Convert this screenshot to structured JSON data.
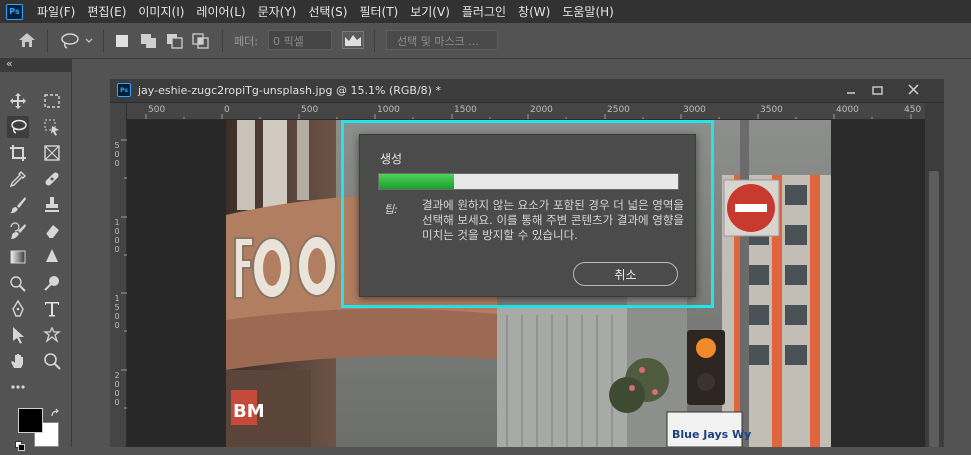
{
  "app": {
    "logo": "Ps"
  },
  "menu": [
    "파일(F)",
    "편집(E)",
    "이미지(I)",
    "레이어(L)",
    "문자(Y)",
    "선택(S)",
    "필터(T)",
    "보기(V)",
    "플러그인",
    "창(W)",
    "도움말(H)"
  ],
  "options_bar": {
    "feather_label": "페더:",
    "feather_value": "0 픽셀",
    "select_and_mask": "선택 및 마스크 ..."
  },
  "tool_panel": {
    "collapse_glyph": "«"
  },
  "document": {
    "title": "jay-eshie-zugc2ropiTg-unsplash.jpg @ 15.1% (RGB/8) *",
    "ruler_h": [
      "500",
      "0",
      "500",
      "1000",
      "1500",
      "2000",
      "2500",
      "3000",
      "3500",
      "4000",
      "450"
    ],
    "ruler_v": [
      "5",
      "0",
      "0",
      "1",
      "0",
      "0",
      "0",
      "1",
      "5",
      "0",
      "0",
      "2",
      "0",
      "0",
      "0"
    ]
  },
  "dialog": {
    "title": "생성",
    "progress": 0.25,
    "tip_label": "팁:",
    "tip_text": "결과에 원하지 않는 요소가 포함된 경우 더 넓은 영역을 선택해 보세요. 이를 통해 주변 콘텐츠가 결과에 영향을 미치는 것을 방지할 수 있습니다.",
    "cancel": "취소"
  },
  "photo_signs": {
    "sign1": "Blue Jays Wy",
    "sign2": "BM"
  },
  "colors": {
    "highlight": "#22e4ea",
    "progress": "#2fb83f",
    "accent": "#31a8ff"
  }
}
